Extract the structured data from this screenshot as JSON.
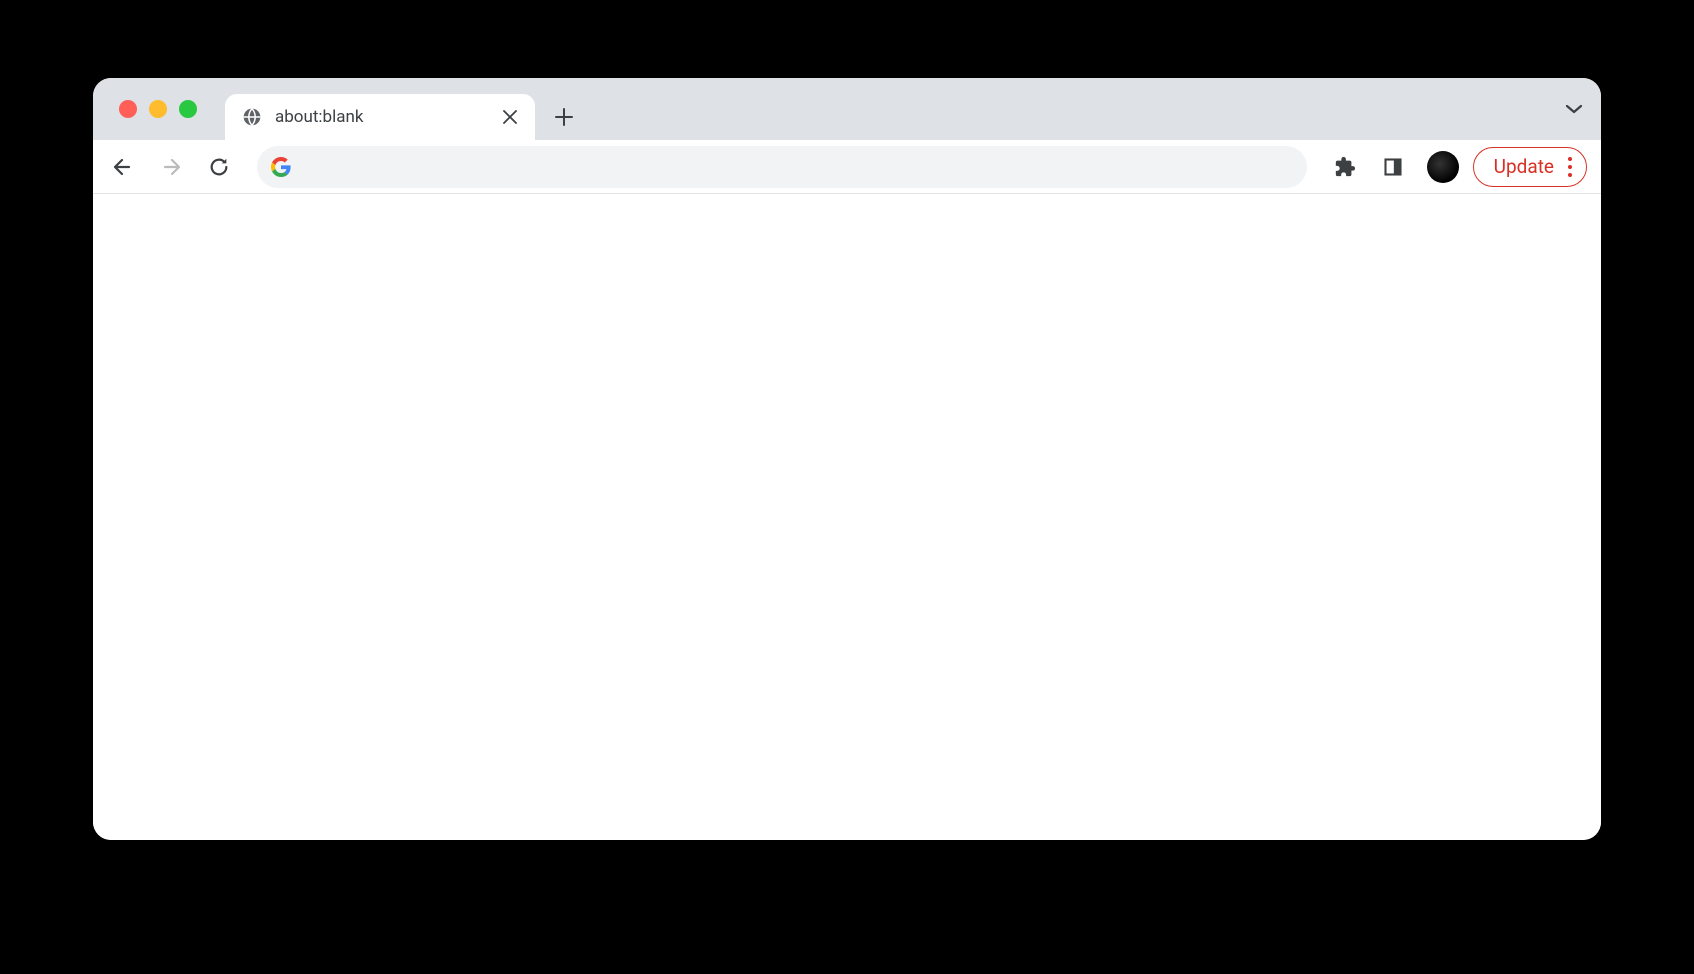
{
  "tab": {
    "title": "about:blank"
  },
  "addressBar": {
    "value": ""
  },
  "updateButton": {
    "label": "Update"
  },
  "colors": {
    "accent": "#d93025",
    "tabBar": "#dee1e6",
    "addressBg": "#f1f3f4"
  }
}
